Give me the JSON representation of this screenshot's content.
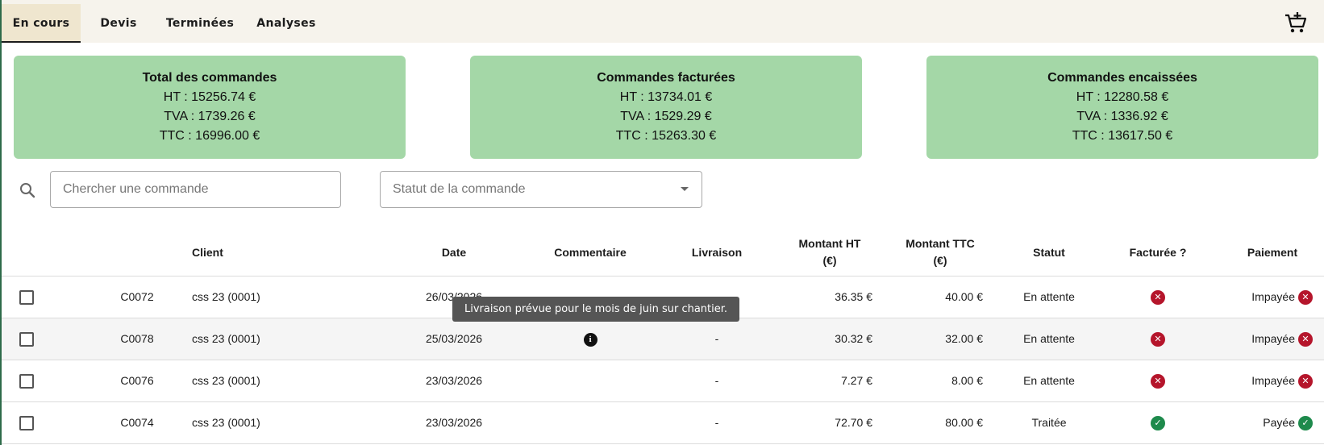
{
  "tabs": [
    {
      "label": "En cours",
      "active": true
    },
    {
      "label": "Devis",
      "active": false
    },
    {
      "label": "Terminées",
      "active": false
    },
    {
      "label": "Analyses",
      "active": false
    }
  ],
  "cart_icon": "add-to-cart-icon",
  "cards": [
    {
      "title": "Total des commandes",
      "ht": "HT : 15256.74 €",
      "tva": "TVA : 1739.26 €",
      "ttc": "TTC : 16996.00 €"
    },
    {
      "title": "Commandes facturées",
      "ht": "HT : 13734.01 €",
      "tva": "TVA : 1529.29 €",
      "ttc": "TTC : 15263.30 €"
    },
    {
      "title": "Commandes encaissées",
      "ht": "HT : 12280.58 €",
      "tva": "TVA : 1336.92 €",
      "ttc": "TTC : 13617.50 €"
    }
  ],
  "colors": {
    "card_bg": "#a4d7a7",
    "active_tab_bg": "#efe6cf",
    "topbar_bg": "#f6f3ec",
    "error_red": "#b5152b",
    "success_green": "#1e8a4c"
  },
  "search": {
    "placeholder": "Chercher une commande",
    "value": ""
  },
  "status_filter": {
    "placeholder": "Statut de la commande"
  },
  "table": {
    "headers": {
      "client": "Client",
      "date": "Date",
      "commentaire": "Commentaire",
      "livraison": "Livraison",
      "montant_ht_1": "Montant HT",
      "montant_ht_2": "(€)",
      "montant_ttc_1": "Montant TTC",
      "montant_ttc_2": "(€)",
      "statut": "Statut",
      "facturee": "Facturée ?",
      "paiement": "Paiement"
    },
    "rows": [
      {
        "checked": false,
        "num": "C0072",
        "client": "css 23 (0001)",
        "date": "26/03/2026",
        "comment": false,
        "livraison": "",
        "ht": "36.35 €",
        "ttc": "40.00 €",
        "statut": "En attente",
        "facturee": false,
        "paiement": "Impayée",
        "paid": false
      },
      {
        "checked": false,
        "num": "C0078",
        "client": "css 23 (0001)",
        "date": "25/03/2026",
        "comment": true,
        "livraison": "-",
        "ht": "30.32 €",
        "ttc": "32.00 €",
        "statut": "En attente",
        "facturee": false,
        "paiement": "Impayée",
        "paid": false
      },
      {
        "checked": false,
        "num": "C0076",
        "client": "css 23 (0001)",
        "date": "23/03/2026",
        "comment": false,
        "livraison": "-",
        "ht": "7.27 €",
        "ttc": "8.00 €",
        "statut": "En attente",
        "facturee": false,
        "paiement": "Impayée",
        "paid": false
      },
      {
        "checked": false,
        "num": "C0074",
        "client": "css 23 (0001)",
        "date": "23/03/2026",
        "comment": false,
        "livraison": "-",
        "ht": "72.70 €",
        "ttc": "80.00 €",
        "statut": "Traitée",
        "facturee": true,
        "paiement": "Payée",
        "paid": true
      }
    ]
  },
  "tooltip": {
    "text": "Livraison prévue pour le mois de juin sur chantier."
  }
}
